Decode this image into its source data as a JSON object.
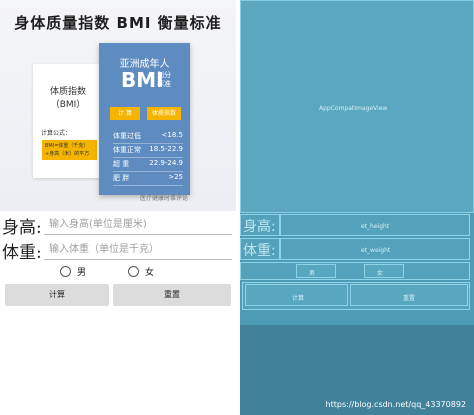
{
  "banner": {
    "title": "身体质量指数 BMI 衡量标准",
    "card_left_title": "体质指数\n（BMI）",
    "formula_label": "计算公式：",
    "formula_text": "BMI=体重（千克）\n÷身高（米）的平方",
    "card_right_subtitle": "亚洲成年人",
    "card_right_bmi": "BMI",
    "card_right_tag": "划分\n标准",
    "yellow_btn_1": "计 算",
    "yellow_btn_2": "体质指数",
    "rows": [
      {
        "label": "体重过低",
        "value": "<18.5"
      },
      {
        "label": "体重正常",
        "value": "18.5-22.9"
      },
      {
        "label": "超 重",
        "value": "22.9-24.9"
      },
      {
        "label": "肥 胖",
        "value": ">25"
      }
    ],
    "watermark": "医疗健康时事评论"
  },
  "form": {
    "height_label": "身高:",
    "height_placeholder": "输入身高(单位是厘米)",
    "weight_label": "体重:",
    "weight_placeholder": "输入体重（单位是千克）",
    "radio_male": "男",
    "radio_female": "女",
    "calc_button": "计算",
    "reset_button": "重置"
  },
  "blueprint": {
    "image_label": "AppCompatImageView",
    "height_label": "身高:",
    "height_id": "et_height",
    "weight_label": "体重:",
    "weight_id": "et_weight",
    "radio_male": "男",
    "radio_female": "女",
    "calc_button": "计算",
    "reset_button": "重置"
  },
  "footer": {
    "csdn_url": "https://blog.csdn.net/qq_43370892"
  },
  "colors": {
    "blueprint_bg": "#4d9bb4",
    "card_blue": "#5e8bc0",
    "accent_yellow": "#f4b400",
    "button_grey": "#dcdcdc"
  }
}
